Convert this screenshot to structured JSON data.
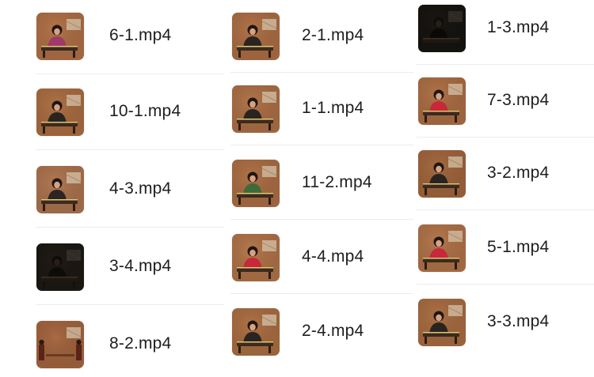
{
  "file_grid": {
    "columns": [
      {
        "items": [
          {
            "name": "6-1.mp4",
            "thumb": "guzheng-red-performer-thumbnail",
            "bg": "#b5764b",
            "figure": "#3a2a28",
            "top": "#9e3b6a"
          },
          {
            "name": "10-1.mp4",
            "thumb": "guzheng-performer-thumbnail",
            "bg": "#b07346",
            "figure": "#2a2420",
            "top": "#2a2420"
          },
          {
            "name": "4-3.mp4",
            "thumb": "guzheng-singer-thumbnail",
            "bg": "#b27a55",
            "figure": "#2c2422",
            "top": "#2c2422"
          },
          {
            "name": "3-4.mp4",
            "thumb": "guzheng-dark-stage-thumbnail",
            "bg": "#3b3228",
            "figure": "#1a1614",
            "top": "#1a1614"
          },
          {
            "name": "8-2.mp4",
            "thumb": "guzheng-duet-thumbnail",
            "bg": "#a86a43",
            "figure": "#5a2418",
            "top": "#5a2418"
          }
        ]
      },
      {
        "items": [
          {
            "name": "2-1.mp4",
            "thumb": "guzheng-performer-thumbnail",
            "bg": "#b27449",
            "figure": "#2a2420",
            "top": "#2a2420"
          },
          {
            "name": "1-1.mp4",
            "thumb": "guzheng-performer-thumbnail",
            "bg": "#b3764b",
            "figure": "#2a2420",
            "top": "#2a2420"
          },
          {
            "name": "11-2.mp4",
            "thumb": "guzheng-green-performer-thumbnail",
            "bg": "#b27449",
            "figure": "#2a2420",
            "top": "#3f6b3a"
          },
          {
            "name": "4-4.mp4",
            "thumb": "guzheng-red-performer-thumbnail",
            "bg": "#b77a4e",
            "figure": "#2a2420",
            "top": "#c8283a"
          },
          {
            "name": "2-4.mp4",
            "thumb": "guzheng-performer-thumbnail",
            "bg": "#b07447",
            "figure": "#2a2420",
            "top": "#2a2420"
          }
        ]
      },
      {
        "items": [
          {
            "name": "1-3.mp4",
            "thumb": "guzheng-dark-stage-thumbnail",
            "bg": "#2f2a22",
            "figure": "#141210",
            "top": "#141210"
          },
          {
            "name": "7-3.mp4",
            "thumb": "guzheng-red-performer-thumbnail",
            "bg": "#b27449",
            "figure": "#2a2420",
            "top": "#c8283a"
          },
          {
            "name": "3-2.mp4",
            "thumb": "guzheng-performer-thumbnail",
            "bg": "#a66b41",
            "figure": "#2a2420",
            "top": "#2a2420"
          },
          {
            "name": "5-1.mp4",
            "thumb": "guzheng-red-performer-thumbnail",
            "bg": "#b77a4e",
            "figure": "#2a2420",
            "top": "#c8283a"
          },
          {
            "name": "3-3.mp4",
            "thumb": "guzheng-performer-thumbnail",
            "bg": "#ad7246",
            "figure": "#2a2420",
            "top": "#2a2420"
          }
        ]
      }
    ]
  }
}
